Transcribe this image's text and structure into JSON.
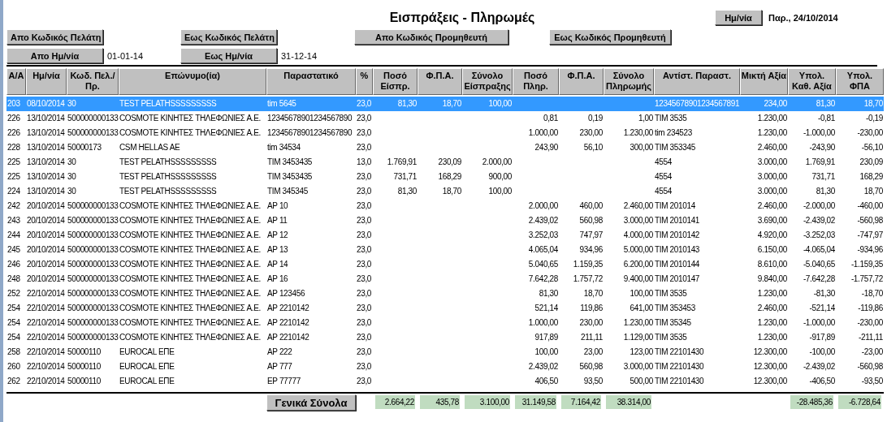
{
  "title": "Εισπράξεις - Πληρωμές",
  "date_button": {
    "label": "Ημ/νία",
    "value": "Παρ., 24/10/2014"
  },
  "filter_buttons": [
    {
      "label": "Απο Κωδικός Πελάτη"
    },
    {
      "label": "Εως Κωδικός Πελάτη"
    },
    {
      "label": "Απο Κωδικός Προμηθευτή"
    },
    {
      "label": "Εως Κωδικός Προμηθευτή"
    }
  ],
  "date_filters": [
    {
      "label": "Απο Ημ/νία",
      "value": "01-01-14"
    },
    {
      "label": "Εως Ημ/νία",
      "value": "31-12-14"
    }
  ],
  "table": {
    "columns": [
      "Α/Α",
      "Ημ/νία",
      "Κωδ. Πελ./Πρ.",
      "Επώνυμο(ία)",
      "Παραστατικό",
      "%",
      "Ποσό Είσπρ.",
      "Φ.Π.Α.",
      "Σύνολο Είσπραξης",
      "Ποσό Πληρ.",
      "Φ.Π.Α.",
      "Σύνολο Πληρωμής",
      "Αντίστ. Παραστ.",
      "Μικτή Αξία",
      "Υπολ. Καθ.  Αξία",
      "Υπολ. ΦΠΑ"
    ],
    "rows": [
      {
        "selected": true,
        "cells": [
          "203",
          "08/10/2014",
          "30",
          "TEST PELATHSSSSSSSSS",
          "tim 5645",
          "23,0",
          "81,30",
          "18,70",
          "100,00",
          null,
          null,
          null,
          "12345678901234567891",
          "234,00",
          "81,30",
          "18,70"
        ]
      },
      {
        "selected": false,
        "cells": [
          "226",
          "13/10/2014",
          "500000000133",
          "COSMOTE ΚΙΝΗΤΕΣ ΤΗΛΕΦΩΝΙΕΣ Α.Ε.",
          "12345678901234567890",
          "23,0",
          null,
          null,
          null,
          "0,81",
          "0,19",
          "1,00",
          "TIM 3535",
          "1.230,00",
          "-0,81",
          "-0,19"
        ]
      },
      {
        "selected": false,
        "cells": [
          "226",
          "13/10/2014",
          "500000000133",
          "COSMOTE ΚΙΝΗΤΕΣ ΤΗΛΕΦΩΝΙΕΣ Α.Ε.",
          "12345678901234567890",
          "23,0",
          null,
          null,
          null,
          "1.000,00",
          "230,00",
          "1.230,00",
          "tim 234523",
          "1.230,00",
          "-1.000,00",
          "-230,00"
        ]
      },
      {
        "selected": false,
        "cells": [
          "228",
          "13/10/2014",
          "50000173",
          "CSM HELLAS AE",
          "tim 34534",
          "23,0",
          null,
          null,
          null,
          "243,90",
          "56,10",
          "300,00",
          "TIM  353345",
          "2.460,00",
          "-243,90",
          "-56,10"
        ]
      },
      {
        "selected": false,
        "cells": [
          "225",
          "13/10/2014",
          "30",
          "TEST PELATHSSSSSSSSS",
          "TIM 3453435",
          "13,0",
          "1.769,91",
          "230,09",
          "2.000,00",
          null,
          null,
          null,
          "4554",
          "3.000,00",
          "1.769,91",
          "230,09"
        ]
      },
      {
        "selected": false,
        "cells": [
          "225",
          "13/10/2014",
          "30",
          "TEST PELATHSSSSSSSSS",
          "TIM 3453435",
          "23,0",
          "731,71",
          "168,29",
          "900,00",
          null,
          null,
          null,
          "4554",
          "3.000,00",
          "731,71",
          "168,29"
        ]
      },
      {
        "selected": false,
        "cells": [
          "224",
          "13/10/2014",
          "30",
          "TEST PELATHSSSSSSSSS",
          "TIM 345345",
          "23,0",
          "81,30",
          "18,70",
          "100,00",
          null,
          null,
          null,
          "4554",
          "3.000,00",
          "81,30",
          "18,70"
        ]
      },
      {
        "selected": false,
        "cells": [
          "242",
          "20/10/2014",
          "500000000133",
          "COSMOTE ΚΙΝΗΤΕΣ ΤΗΛΕΦΩΝΙΕΣ Α.Ε.",
          "AP 10",
          "23,0",
          null,
          null,
          null,
          "2.000,00",
          "460,00",
          "2.460,00",
          "TIM 201014",
          "2.460,00",
          "-2.000,00",
          "-460,00"
        ]
      },
      {
        "selected": false,
        "cells": [
          "243",
          "20/10/2014",
          "500000000133",
          "COSMOTE ΚΙΝΗΤΕΣ ΤΗΛΕΦΩΝΙΕΣ Α.Ε.",
          "AP 11",
          "23,0",
          null,
          null,
          null,
          "2.439,02",
          "560,98",
          "3.000,00",
          "TIM 2010141",
          "3.690,00",
          "-2.439,02",
          "-560,98"
        ]
      },
      {
        "selected": false,
        "cells": [
          "244",
          "20/10/2014",
          "500000000133",
          "COSMOTE ΚΙΝΗΤΕΣ ΤΗΛΕΦΩΝΙΕΣ Α.Ε.",
          "AP 12",
          "23,0",
          null,
          null,
          null,
          "3.252,03",
          "747,97",
          "4.000,00",
          "TIM 2010142",
          "4.920,00",
          "-3.252,03",
          "-747,97"
        ]
      },
      {
        "selected": false,
        "cells": [
          "245",
          "20/10/2014",
          "500000000133",
          "COSMOTE ΚΙΝΗΤΕΣ ΤΗΛΕΦΩΝΙΕΣ Α.Ε.",
          "AP 13",
          "23,0",
          null,
          null,
          null,
          "4.065,04",
          "934,96",
          "5.000,00",
          "TIM 2010143",
          "6.150,00",
          "-4.065,04",
          "-934,96"
        ]
      },
      {
        "selected": false,
        "cells": [
          "246",
          "20/10/2014",
          "500000000133",
          "COSMOTE ΚΙΝΗΤΕΣ ΤΗΛΕΦΩΝΙΕΣ Α.Ε.",
          "AP 14",
          "23,0",
          null,
          null,
          null,
          "5.040,65",
          "1.159,35",
          "6.200,00",
          "TIM 2010144",
          "8.610,00",
          "-5.040,65",
          "-1.159,35"
        ]
      },
      {
        "selected": false,
        "cells": [
          "248",
          "20/10/2014",
          "500000000133",
          "COSMOTE ΚΙΝΗΤΕΣ ΤΗΛΕΦΩΝΙΕΣ Α.Ε.",
          "AP 16",
          "23,0",
          null,
          null,
          null,
          "7.642,28",
          "1.757,72",
          "9.400,00",
          "TIM 2010147",
          "9.840,00",
          "-7.642,28",
          "-1.757,72"
        ]
      },
      {
        "selected": false,
        "cells": [
          "252",
          "22/10/2014",
          "500000000133",
          "COSMOTE ΚΙΝΗΤΕΣ ΤΗΛΕΦΩΝΙΕΣ Α.Ε.",
          "AP 123456",
          "23,0",
          null,
          null,
          null,
          "81,30",
          "18,70",
          "100,00",
          "TIM 3535",
          "1.230,00",
          "-81,30",
          "-18,70"
        ]
      },
      {
        "selected": false,
        "cells": [
          "254",
          "22/10/2014",
          "500000000133",
          "COSMOTE ΚΙΝΗΤΕΣ ΤΗΛΕΦΩΝΙΕΣ Α.Ε.",
          "AP 2210142",
          "23,0",
          null,
          null,
          null,
          "521,14",
          "119,86",
          "641,00",
          "TIM 353453",
          "2.460,00",
          "-521,14",
          "-119,86"
        ]
      },
      {
        "selected": false,
        "cells": [
          "254",
          "22/10/2014",
          "500000000133",
          "COSMOTE ΚΙΝΗΤΕΣ ΤΗΛΕΦΩΝΙΕΣ Α.Ε.",
          "AP 2210142",
          "23,0",
          null,
          null,
          null,
          "1.000,00",
          "230,00",
          "1.230,00",
          "TIM 35345",
          "1.230,00",
          "-1.000,00",
          "-230,00"
        ]
      },
      {
        "selected": false,
        "cells": [
          "254",
          "22/10/2014",
          "500000000133",
          "COSMOTE ΚΙΝΗΤΕΣ ΤΗΛΕΦΩΝΙΕΣ Α.Ε.",
          "AP 2210142",
          "23,0",
          null,
          null,
          null,
          "917,89",
          "211,11",
          "1.129,00",
          "TIM 3535",
          "1.230,00",
          "-917,89",
          "-211,11"
        ]
      },
      {
        "selected": false,
        "cells": [
          "258",
          "22/10/2014",
          "50000110",
          "EUROCAL ΕΠΕ",
          "AP 222",
          "23,0",
          null,
          null,
          null,
          "100,00",
          "23,00",
          "123,00",
          "TIM 22101430",
          "12.300,00",
          "-100,00",
          "-23,00"
        ]
      },
      {
        "selected": false,
        "cells": [
          "260",
          "22/10/2014",
          "50000110",
          "EUROCAL ΕΠΕ",
          "AP 777",
          "23,0",
          null,
          null,
          null,
          "2.439,02",
          "560,98",
          "3.000,00",
          "TIM 22101430",
          "12.300,00",
          "-2.439,02",
          "-560,98"
        ]
      },
      {
        "selected": false,
        "cells": [
          "262",
          "22/10/2014",
          "50000110",
          "EUROCAL ΕΠΕ",
          "EP 77777",
          "23,0",
          null,
          null,
          null,
          "406,50",
          "93,50",
          "500,00",
          "TIM 22101430",
          "12.300,00",
          "-406,50",
          "-93,50"
        ]
      }
    ],
    "totals": {
      "label": "Γενικά Σύνολα",
      "cells": [
        null,
        null,
        null,
        null,
        null,
        null,
        "2.664,22",
        "435,78",
        "3.100,00",
        "31.149,58",
        "7.164,42",
        "38.314,00",
        null,
        null,
        "-28.485,36",
        "-6.728,64"
      ]
    }
  }
}
